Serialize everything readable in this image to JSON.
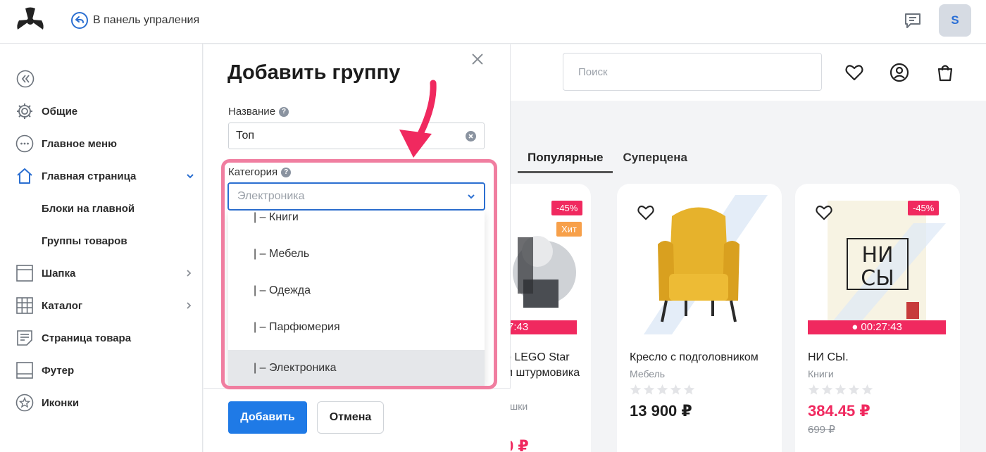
{
  "topbar": {
    "back_label": "В панель упраления",
    "avatar_letter": "S"
  },
  "sidebar": {
    "items": [
      {
        "label": "Общие",
        "icon": "gear-icon"
      },
      {
        "label": "Главное меню",
        "icon": "dots-circle-icon"
      },
      {
        "label": "Главная страница",
        "icon": "home-icon",
        "expanded": true
      },
      {
        "label": "Блоки на главной"
      },
      {
        "label": "Группы товаров"
      },
      {
        "label": "Шапка",
        "icon": "header-layout-icon"
      },
      {
        "label": "Каталог",
        "icon": "grid-icon"
      },
      {
        "label": "Страница товара",
        "icon": "document-icon"
      },
      {
        "label": "Футер",
        "icon": "footer-layout-icon"
      },
      {
        "label": "Иконки",
        "icon": "star-circle-icon"
      }
    ]
  },
  "modal": {
    "title": "Добавить группу",
    "name_label": "Название",
    "name_value": "Топ",
    "category_label": "Категория",
    "category_value": "Электроника",
    "options": [
      "| – Книги",
      "| – Мебель",
      "| – Одежда",
      "| – Парфюмерия",
      "| – Электроника"
    ],
    "selected_option": "| – Электроника",
    "add_button": "Добавить",
    "cancel_button": "Отмена"
  },
  "store": {
    "search_placeholder": "Поиск",
    "tabs": [
      "Популярные",
      "Суперцена"
    ],
    "active_tab": "Популярные",
    "products": [
      {
        "name_line1": "р LEGO Star",
        "name_line2": "м штурмовика",
        "category": "ушки",
        "discount": "-45%",
        "hit": "Хит",
        "timer": "00:27:43",
        "price": "0 ₽"
      },
      {
        "name": "Кресло с подголовником",
        "category": "Мебель",
        "price": "13 900 ₽",
        "rating": 0
      },
      {
        "name": "НИ СЫ.",
        "category": "Книги",
        "discount": "-45%",
        "timer": "00:27:43",
        "price": "384.45 ₽",
        "old_price": "699 ₽",
        "rating": 0,
        "cover_text_1": "НИ",
        "cover_text_2": "СЫ"
      }
    ]
  },
  "colors": {
    "accent": "#1f7ae6",
    "sale": "#f0295f",
    "highlight": "#f07ea0",
    "arrow": "#f0295f"
  }
}
